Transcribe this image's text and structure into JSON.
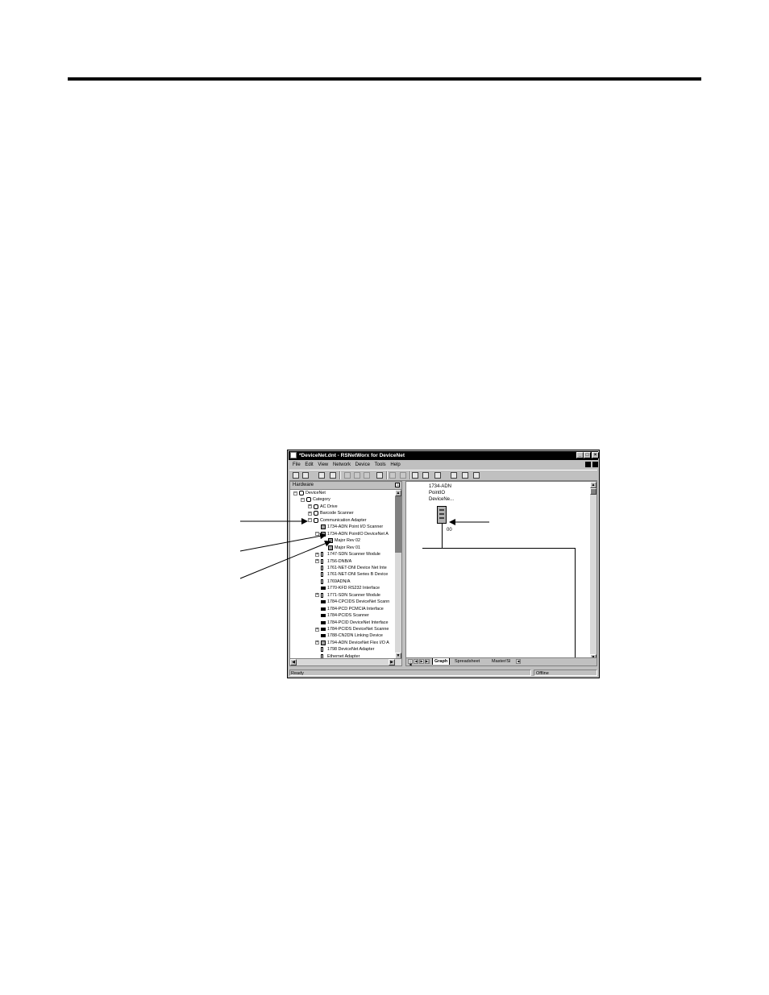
{
  "window": {
    "title": "*DeviceNet.dnt - RSNetWorx for DeviceNet",
    "min_glyph": "_",
    "max_glyph": "□",
    "close_glyph": "×"
  },
  "menubar": [
    "File",
    "Edit",
    "View",
    "Network",
    "Device",
    "Tools",
    "Help"
  ],
  "toolbar_icons": [
    "new-icon",
    "open-icon",
    "save-icon",
    "print-icon",
    "cut-icon",
    "copy-icon",
    "paste-icon",
    "online-icon",
    "upload-icon",
    "download-icon",
    "hardware-view-icon",
    "tree-view-icon",
    "properties-icon",
    "network-icon",
    "report-icon",
    "help-icon"
  ],
  "hardware": {
    "header": "Hardware",
    "tree": [
      {
        "label": "DeviceNet",
        "level": 0,
        "expander": "−",
        "icon": "folder"
      },
      {
        "label": "Category",
        "level": 1,
        "expander": "−",
        "icon": "folder"
      },
      {
        "label": "AC Drive",
        "level": 2,
        "expander": "+",
        "icon": "folder"
      },
      {
        "label": "Barcode Scanner",
        "level": 2,
        "expander": "+",
        "icon": "folder"
      },
      {
        "label": "Communication Adapter",
        "level": 2,
        "expander": "−",
        "icon": "folder"
      },
      {
        "label": "1734-ADN Point I/O Scanner",
        "level": 3,
        "expander": "",
        "icon": "device"
      },
      {
        "label": "1734-ADN PointIO DeviceNet A",
        "level": 3,
        "expander": "−",
        "icon": "device"
      },
      {
        "label": "Major Rev 02",
        "level": 4,
        "expander": "",
        "icon": "device"
      },
      {
        "label": "Major Rev 01",
        "level": 4,
        "expander": "",
        "icon": "device"
      },
      {
        "label": "1747-SDN Scanner Module",
        "level": 3,
        "expander": "+",
        "icon": "thin"
      },
      {
        "label": "1756-DNB/A",
        "level": 3,
        "expander": "+",
        "icon": "thin"
      },
      {
        "label": "1761-NET-DNI Device Net Inte",
        "level": 3,
        "expander": "",
        "icon": "thin"
      },
      {
        "label": "1761-NET-DNI Series B Device",
        "level": 3,
        "expander": "",
        "icon": "thin"
      },
      {
        "label": "1769ADN/A",
        "level": 3,
        "expander": "",
        "icon": "thin"
      },
      {
        "label": "1770-KFD RS232 Interface",
        "level": 3,
        "expander": "",
        "icon": "bar"
      },
      {
        "label": "1771-SDN Scanner Module",
        "level": 3,
        "expander": "+",
        "icon": "thin"
      },
      {
        "label": "1784-CPCIDS DeviceNet Scann",
        "level": 3,
        "expander": "",
        "icon": "bar"
      },
      {
        "label": "1784-PCD PCMCIA Interface",
        "level": 3,
        "expander": "",
        "icon": "bar"
      },
      {
        "label": "1784-PCIDS Scanner",
        "level": 3,
        "expander": "",
        "icon": "bar"
      },
      {
        "label": "1784-PCID DeviceNet Interface",
        "level": 3,
        "expander": "",
        "icon": "bar"
      },
      {
        "label": "1784-PCIDS DeviceNet Scanne",
        "level": 3,
        "expander": "+",
        "icon": "bar"
      },
      {
        "label": "1788-CN2DN Linking Device",
        "level": 3,
        "expander": "",
        "icon": "bar"
      },
      {
        "label": "1794-ADN DeviceNet Flex I/O A",
        "level": 3,
        "expander": "+",
        "icon": "device"
      },
      {
        "label": "1798 DeviceNet Adapter",
        "level": 3,
        "expander": "",
        "icon": "thin"
      },
      {
        "label": "Ethernet Adapter",
        "level": 3,
        "expander": "",
        "icon": "thin"
      }
    ]
  },
  "graph": {
    "device_label_lines": [
      "1734-ADN",
      "PointIO",
      "DeviceNe..."
    ],
    "node_address": "00",
    "tabs": [
      "Graph",
      "Spreadsheet",
      "Master/Sl"
    ],
    "nav_glyphs": [
      "|◀",
      "◀",
      "▶",
      "▶|"
    ]
  },
  "status": {
    "left": "Ready",
    "right": "Offline"
  }
}
